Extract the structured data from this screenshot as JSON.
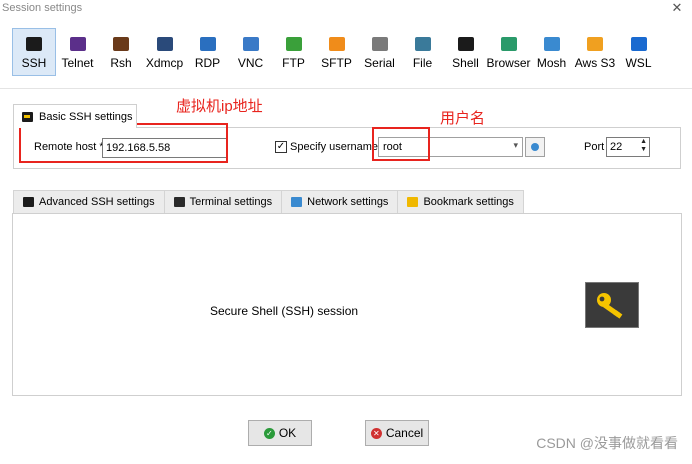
{
  "window": {
    "title": "Session settings",
    "close_label": "✕"
  },
  "toolbar": {
    "items": [
      {
        "label": "SSH",
        "icon": "ssh-icon",
        "color": "#1b1b1b",
        "active": true
      },
      {
        "label": "Telnet",
        "icon": "telnet-icon",
        "color": "#5b2f8a"
      },
      {
        "label": "Rsh",
        "icon": "rsh-icon",
        "color": "#6a3a1a"
      },
      {
        "label": "Xdmcp",
        "icon": "xdmcp-icon",
        "color": "#2a4a7a"
      },
      {
        "label": "RDP",
        "icon": "rdp-icon",
        "color": "#2a6fbf"
      },
      {
        "label": "VNC",
        "icon": "vnc-icon",
        "color": "#3a7ac7"
      },
      {
        "label": "FTP",
        "icon": "ftp-icon",
        "color": "#3aa03a"
      },
      {
        "label": "SFTP",
        "icon": "sftp-icon",
        "color": "#f08c1a"
      },
      {
        "label": "Serial",
        "icon": "serial-icon",
        "color": "#7a7a7a"
      },
      {
        "label": "File",
        "icon": "file-icon",
        "color": "#3a7a9a"
      },
      {
        "label": "Shell",
        "icon": "shell-icon",
        "color": "#1b1b1b"
      },
      {
        "label": "Browser",
        "icon": "browser-icon",
        "color": "#2a9a6a"
      },
      {
        "label": "Mosh",
        "icon": "mosh-icon",
        "color": "#3a8ad0"
      },
      {
        "label": "Aws S3",
        "icon": "aws-s3-icon",
        "color": "#f0a020"
      },
      {
        "label": "WSL",
        "icon": "wsl-icon",
        "color": "#1a6ad0"
      }
    ]
  },
  "basic": {
    "tab_label": "Basic SSH settings",
    "remote_host_label": "Remote host *",
    "remote_host_value": "192.168.5.58",
    "specify_username_label": "Specify username",
    "specify_username_checked": "✓",
    "username_value": "root",
    "port_label": "Port",
    "port_value": "22"
  },
  "annotations": {
    "host_note": "虚拟机ip地址",
    "user_note": "用户名"
  },
  "tabs": [
    {
      "label": "Advanced SSH settings",
      "icon": "ssh-settings-icon",
      "color": "#1b1b1b"
    },
    {
      "label": "Terminal settings",
      "icon": "terminal-icon",
      "color": "#2a2a2a"
    },
    {
      "label": "Network settings",
      "icon": "network-icon",
      "color": "#3a8ad0"
    },
    {
      "label": "Bookmark settings",
      "icon": "star-icon",
      "color": "#f0b800"
    }
  ],
  "session": {
    "label": "Secure Shell (SSH) session"
  },
  "buttons": {
    "ok": {
      "label": "OK",
      "color": "#2a9a3a",
      "glyph": "✓"
    },
    "cancel": {
      "label": "Cancel",
      "color": "#d03030",
      "glyph": "✕"
    }
  },
  "watermark": "CSDN @没事做就看看"
}
